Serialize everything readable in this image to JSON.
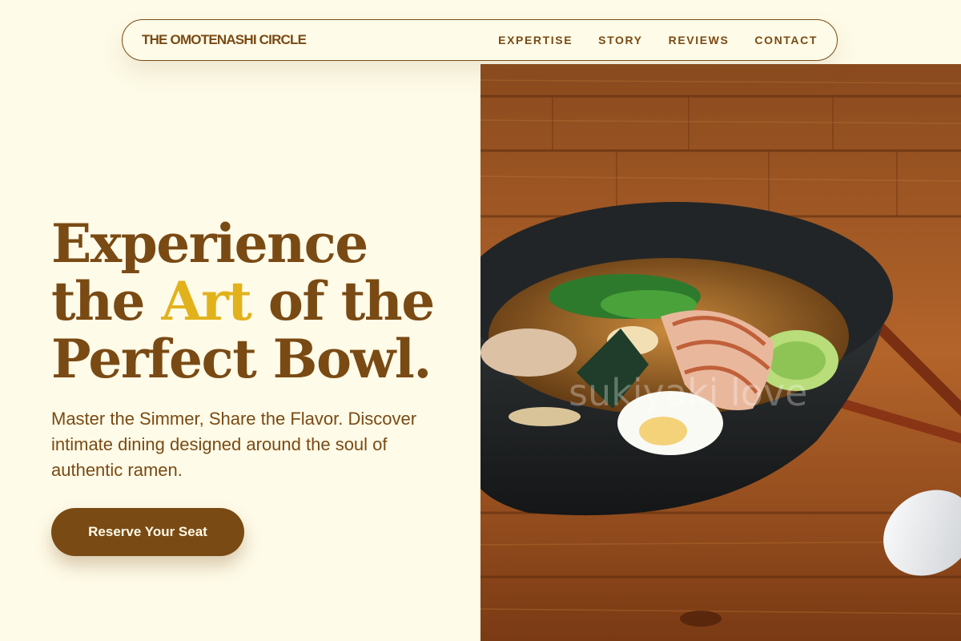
{
  "nav": {
    "brand": "THE OMOTENASHI CIRCLE",
    "links": [
      "EXPERTISE",
      "STORY",
      "REVIEWS",
      "CONTACT"
    ]
  },
  "hero": {
    "title_line1": "Experience",
    "title_line2_pre": "the ",
    "title_line2_accent": "Art",
    "title_line2_post": " of the",
    "title_line3": "Perfect Bowl.",
    "subtitle": "Master the Simmer, Share the Flavor. Discover intimate dining designed around the soul of authentic ramen.",
    "cta_label": "Reserve Your Seat",
    "image_watermark": "sukiyaki love"
  },
  "colors": {
    "background": "#fefbe8",
    "brand_brown": "#7a4a14",
    "accent_gold": "#e2b21c"
  },
  "icons": {
    "hero_image": "ramen-bowl-photo"
  }
}
